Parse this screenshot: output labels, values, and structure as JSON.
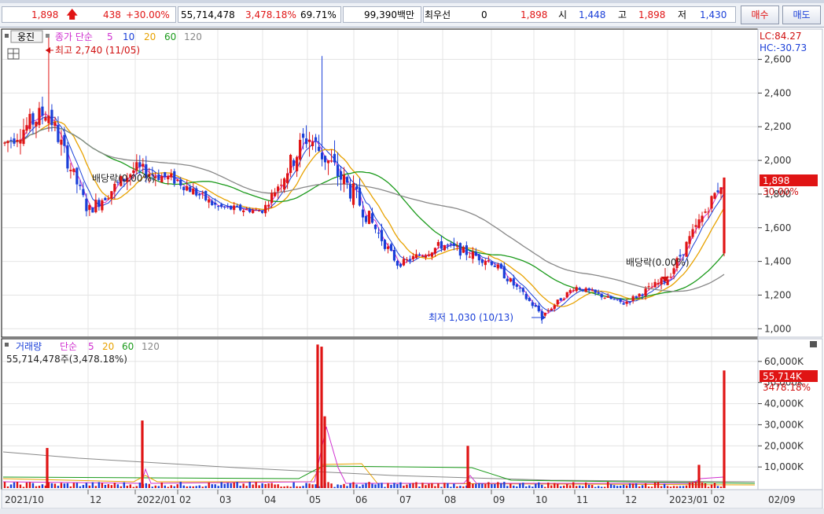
{
  "quote_bar": {
    "price": "1,898",
    "change": "438",
    "change_pct": "+30.00%",
    "volume": "55,714,478",
    "volume_ratio": "3,478.18%",
    "turnover": "69.71%",
    "amount": "99,390백만",
    "best_bid_label": "최우선",
    "best_bid_qty": "0",
    "best_bid_price": "1,898",
    "open_label": "시",
    "open": "1,448",
    "high_label": "고",
    "high": "1,898",
    "low_label": "저",
    "low": "1,430",
    "buy_label": "매수",
    "sell_label": "매도"
  },
  "price_panel": {
    "stock_name": "웅진",
    "ma_legend_prefix": "종가 단순",
    "ma_periods": [
      "5",
      "10",
      "20",
      "60",
      "120"
    ],
    "lc": "LC:84.27",
    "hc": "HC:-30.73",
    "current_price_label": "1,898",
    "current_change_label": "30.00%",
    "annotations": {
      "high": "최고 2,740 (11/05)",
      "low": "최저 1,030 (10/13)",
      "dividend1": "배당락(0.00%)",
      "dividend2": "배당락(0.00%)"
    }
  },
  "volume_panel": {
    "title": "거래량",
    "ma_label": "단순",
    "ma_periods": [
      "5",
      "20",
      "60",
      "120"
    ],
    "info": "55,714,478주(3,478.18%)",
    "current_volume_label": "55,714K",
    "current_ratio_label": "3478.18%"
  },
  "colors": {
    "up": "#e01414",
    "down": "#1a3fd8",
    "ma5": "#d030d0",
    "ma10": "#1a3fd8",
    "ma20": "#e8a200",
    "ma60": "#1a9a1a",
    "ma120": "#888888"
  },
  "chart_data": [
    {
      "type": "candlestick",
      "title": "웅진",
      "ylim": [
        950,
        2780
      ],
      "y_ticks": [
        1000,
        1200,
        1400,
        1600,
        1800,
        2000,
        2200,
        2400,
        2600
      ],
      "y_tick_labels": [
        "1,000",
        "1,200",
        "1,400",
        "1,600",
        "1,800",
        "2,000",
        "2,200",
        "2,400",
        "2,600"
      ],
      "x_axis_labels": [
        "2021/10",
        "12",
        "2022/01",
        "02",
        "03",
        "04",
        "05",
        "06",
        "07",
        "08",
        "09",
        "10",
        "11",
        "12",
        "2023/01",
        "02",
        "02/09"
      ],
      "series_approx": {
        "dates": [
          "2021/10",
          "2021/11/05",
          "2021/12",
          "2022/01",
          "2022/02",
          "2022/03",
          "2022/04",
          "2022/05",
          "2022/06",
          "2022/07",
          "2022/08",
          "2022/09",
          "2022/10/13",
          "2022/11",
          "2022/12",
          "2023/01",
          "2023/02/09"
        ],
        "close": [
          2100,
          2300,
          1700,
          1950,
          1880,
          1720,
          1700,
          2150,
          1800,
          1380,
          1500,
          1400,
          1080,
          1250,
          1150,
          1300,
          1898
        ],
        "high": [
          2400,
          2740,
          2000,
          2150,
          2100,
          1950,
          1820,
          2620,
          2300,
          1500,
          1720,
          1550,
          1200,
          1320,
          1280,
          1500,
          1898
        ],
        "low": [
          1850,
          2000,
          1600,
          1650,
          1700,
          1650,
          1650,
          1680,
          1600,
          1300,
          1380,
          1250,
          1030,
          1150,
          1120,
          1200,
          1430
        ]
      },
      "annotations": [
        "최고 2,740 (11/05)",
        "최저 1,030 (10/13)",
        "배당락(0.00%)",
        "배당락(0.00%)"
      ]
    },
    {
      "type": "bar",
      "title": "거래량",
      "ylim": [
        0,
        70000
      ],
      "y_ticks": [
        10000,
        20000,
        30000,
        40000,
        50000,
        60000
      ],
      "y_tick_labels": [
        "10,000K",
        "20,000K",
        "30,000K",
        "40,000K",
        "50,000K",
        "60,000K"
      ],
      "spikes": [
        {
          "date": "2021/10",
          "value": 19000
        },
        {
          "date": "2022/01",
          "value": 32000
        },
        {
          "date": "2022/05",
          "value": 68000
        },
        {
          "date": "2022/05",
          "value": 67000
        },
        {
          "date": "2022/05",
          "value": 34000
        },
        {
          "date": "2022/08",
          "value": 20000
        },
        {
          "date": "2023/01",
          "value": 11000
        },
        {
          "date": "2023/02/09",
          "value": 55714
        }
      ]
    }
  ]
}
